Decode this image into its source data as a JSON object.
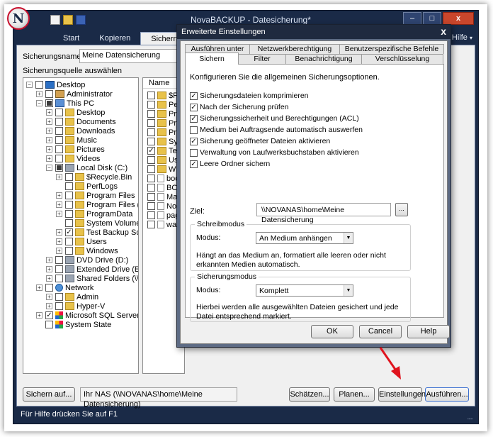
{
  "window": {
    "title": "NovaBACKUP - Datesicherung*",
    "logo_letter": "N",
    "min": "–",
    "max": "□",
    "close": "x"
  },
  "ribbon": {
    "tabs": [
      "Start",
      "Kopieren",
      "Sichern",
      "Wi"
    ],
    "help": "Hilfe",
    "help_arrow": "▾"
  },
  "form": {
    "name_label": "Sicherungsname:",
    "name_value": "Meine Datensicherung",
    "source_label": "Sicherungsquelle auswählen"
  },
  "tree": {
    "items": [
      {
        "label": "Desktop",
        "check": "",
        "icon": "desk",
        "expand": "−"
      },
      {
        "label": "Administrator",
        "check": "",
        "icon": "user",
        "expand": "+"
      },
      {
        "label": "This PC",
        "check": "partial",
        "icon": "pc",
        "expand": "−"
      },
      {
        "label": "Desktop",
        "check": "",
        "icon": "folder",
        "expand": "+"
      },
      {
        "label": "Documents",
        "check": "",
        "icon": "folder",
        "expand": "+"
      },
      {
        "label": "Downloads",
        "check": "",
        "icon": "folder",
        "expand": "+"
      },
      {
        "label": "Music",
        "check": "",
        "icon": "folder",
        "expand": "+"
      },
      {
        "label": "Pictures",
        "check": "",
        "icon": "folder",
        "expand": "+"
      },
      {
        "label": "Videos",
        "check": "",
        "icon": "folder",
        "expand": "+"
      },
      {
        "label": "Local Disk (C:)",
        "check": "partial",
        "icon": "drive",
        "expand": "−"
      },
      {
        "label": "$Recycle.Bin",
        "check": "",
        "icon": "folder",
        "expand": "+"
      },
      {
        "label": "PerfLogs",
        "check": "",
        "icon": "folder",
        "expand": ""
      },
      {
        "label": "Program Files",
        "check": "",
        "icon": "folder",
        "expand": "+"
      },
      {
        "label": "Program Files (",
        "check": "",
        "icon": "folder",
        "expand": "+"
      },
      {
        "label": "ProgramData",
        "check": "",
        "icon": "folder",
        "expand": "+"
      },
      {
        "label": "System Volume",
        "check": "",
        "icon": "folder",
        "expand": ""
      },
      {
        "label": "Test Backup So",
        "check": "✓",
        "icon": "folder",
        "expand": "+"
      },
      {
        "label": "Users",
        "check": "",
        "icon": "folder",
        "expand": "+"
      },
      {
        "label": "Windows",
        "check": "",
        "icon": "folder",
        "expand": "+"
      },
      {
        "label": "DVD Drive (D:)",
        "check": "",
        "icon": "drive",
        "expand": "+"
      },
      {
        "label": "Extended Drive (E",
        "check": "",
        "icon": "drive",
        "expand": "+"
      },
      {
        "label": "Shared Folders (\\\\",
        "check": "",
        "icon": "drive",
        "expand": "+"
      },
      {
        "label": "Network",
        "check": "",
        "icon": "net",
        "expand": "+"
      },
      {
        "label": "Admin",
        "check": "",
        "icon": "folder",
        "expand": "+"
      },
      {
        "label": "Hyper-V",
        "check": "",
        "icon": "folder",
        "expand": "+"
      },
      {
        "label": "Microsoft SQL Server",
        "check": "✓",
        "icon": "win",
        "expand": "+"
      },
      {
        "label": "System State",
        "check": "",
        "icon": "win",
        "expand": ""
      }
    ]
  },
  "list": {
    "header": "Name",
    "items": [
      {
        "label": "$Rec",
        "check": "",
        "icon": "folder"
      },
      {
        "label": "Perfl",
        "check": "",
        "icon": "folder"
      },
      {
        "label": "Prog",
        "check": "",
        "icon": "folder"
      },
      {
        "label": "Prog",
        "check": "",
        "icon": "folder"
      },
      {
        "label": "Prog",
        "check": "",
        "icon": "folder"
      },
      {
        "label": "Syst",
        "check": "",
        "icon": "folder"
      },
      {
        "label": "Test",
        "check": "✓",
        "icon": "folder"
      },
      {
        "label": "User",
        "check": "",
        "icon": "folder"
      },
      {
        "label": "Wind",
        "check": "",
        "icon": "folder"
      },
      {
        "label": "boot",
        "check": "",
        "icon": "file"
      },
      {
        "label": "BOO",
        "check": "",
        "icon": "file"
      },
      {
        "label": "Manu",
        "check": "",
        "icon": "file"
      },
      {
        "label": "Nova",
        "check": "",
        "icon": "file"
      },
      {
        "label": "page",
        "check": "",
        "icon": "file"
      },
      {
        "label": "wallp",
        "check": "",
        "icon": "file"
      }
    ]
  },
  "bottom": {
    "save_to": "Sichern auf...",
    "path": "Ihr NAS (\\\\NOVANAS\\home\\Meine Datensicherung)",
    "estimate": "Schätzen...",
    "schedule": "Planen...",
    "settings": "Einstellungen",
    "run": "Ausführen..."
  },
  "status": {
    "text": "Für Hilfe drücken Sie auf F1",
    "grip": "....."
  },
  "dialog": {
    "title": "Erweiterte Einstellungen",
    "close": "x",
    "tabs_back": [
      "Ausführen unter",
      "Netzwerkberechtigung",
      "Benutzerspezifische Befehle"
    ],
    "tabs_front": [
      "Sichern",
      "Filter",
      "Benachrichtigung",
      "Verschlüsselung"
    ],
    "intro": "Konfigurieren Sie die allgemeinen Sicherungsoptionen.",
    "options": [
      {
        "label": "Sicherungsdateien komprimieren",
        "check": "✓"
      },
      {
        "label": "Nach der Sicherung prüfen",
        "check": "✓"
      },
      {
        "label": "Sicherungssicherheit und Berechtigungen (ACL)",
        "check": "✓"
      },
      {
        "label": "Medium bei Auftragsende automatisch auswerfen",
        "check": ""
      },
      {
        "label": "Sicherung geöffneter Dateien aktivieren",
        "check": "✓"
      },
      {
        "label": "Verwaltung von Laufwerksbuchstaben aktivieren",
        "check": ""
      },
      {
        "label": "Leere Ordner sichern",
        "check": "✓"
      }
    ],
    "target_label": "Ziel:",
    "target_value": "\\\\NOVANAS\\home\\Meine Datensicherung",
    "browse": "...",
    "write_group": {
      "title": "Schreibmodus",
      "mode_label": "Modus:",
      "mode_value": "An Medium anhängen",
      "desc": "Hängt an das Medium an, formatiert alle leeren oder nicht erkannten Medien automatisch."
    },
    "backup_group": {
      "title": "Sicherungsmodus",
      "mode_label": "Modus:",
      "mode_value": "Komplett",
      "desc": "Hierbei werden alle ausgewählten Dateien gesichert und jede Datei entsprechend markiert."
    },
    "dropdown_arrow": "▼",
    "ok": "OK",
    "cancel": "Cancel",
    "help": "Help"
  },
  "colors": {
    "frame": "#1a2a47",
    "accent_arrow": "#e0141e"
  }
}
